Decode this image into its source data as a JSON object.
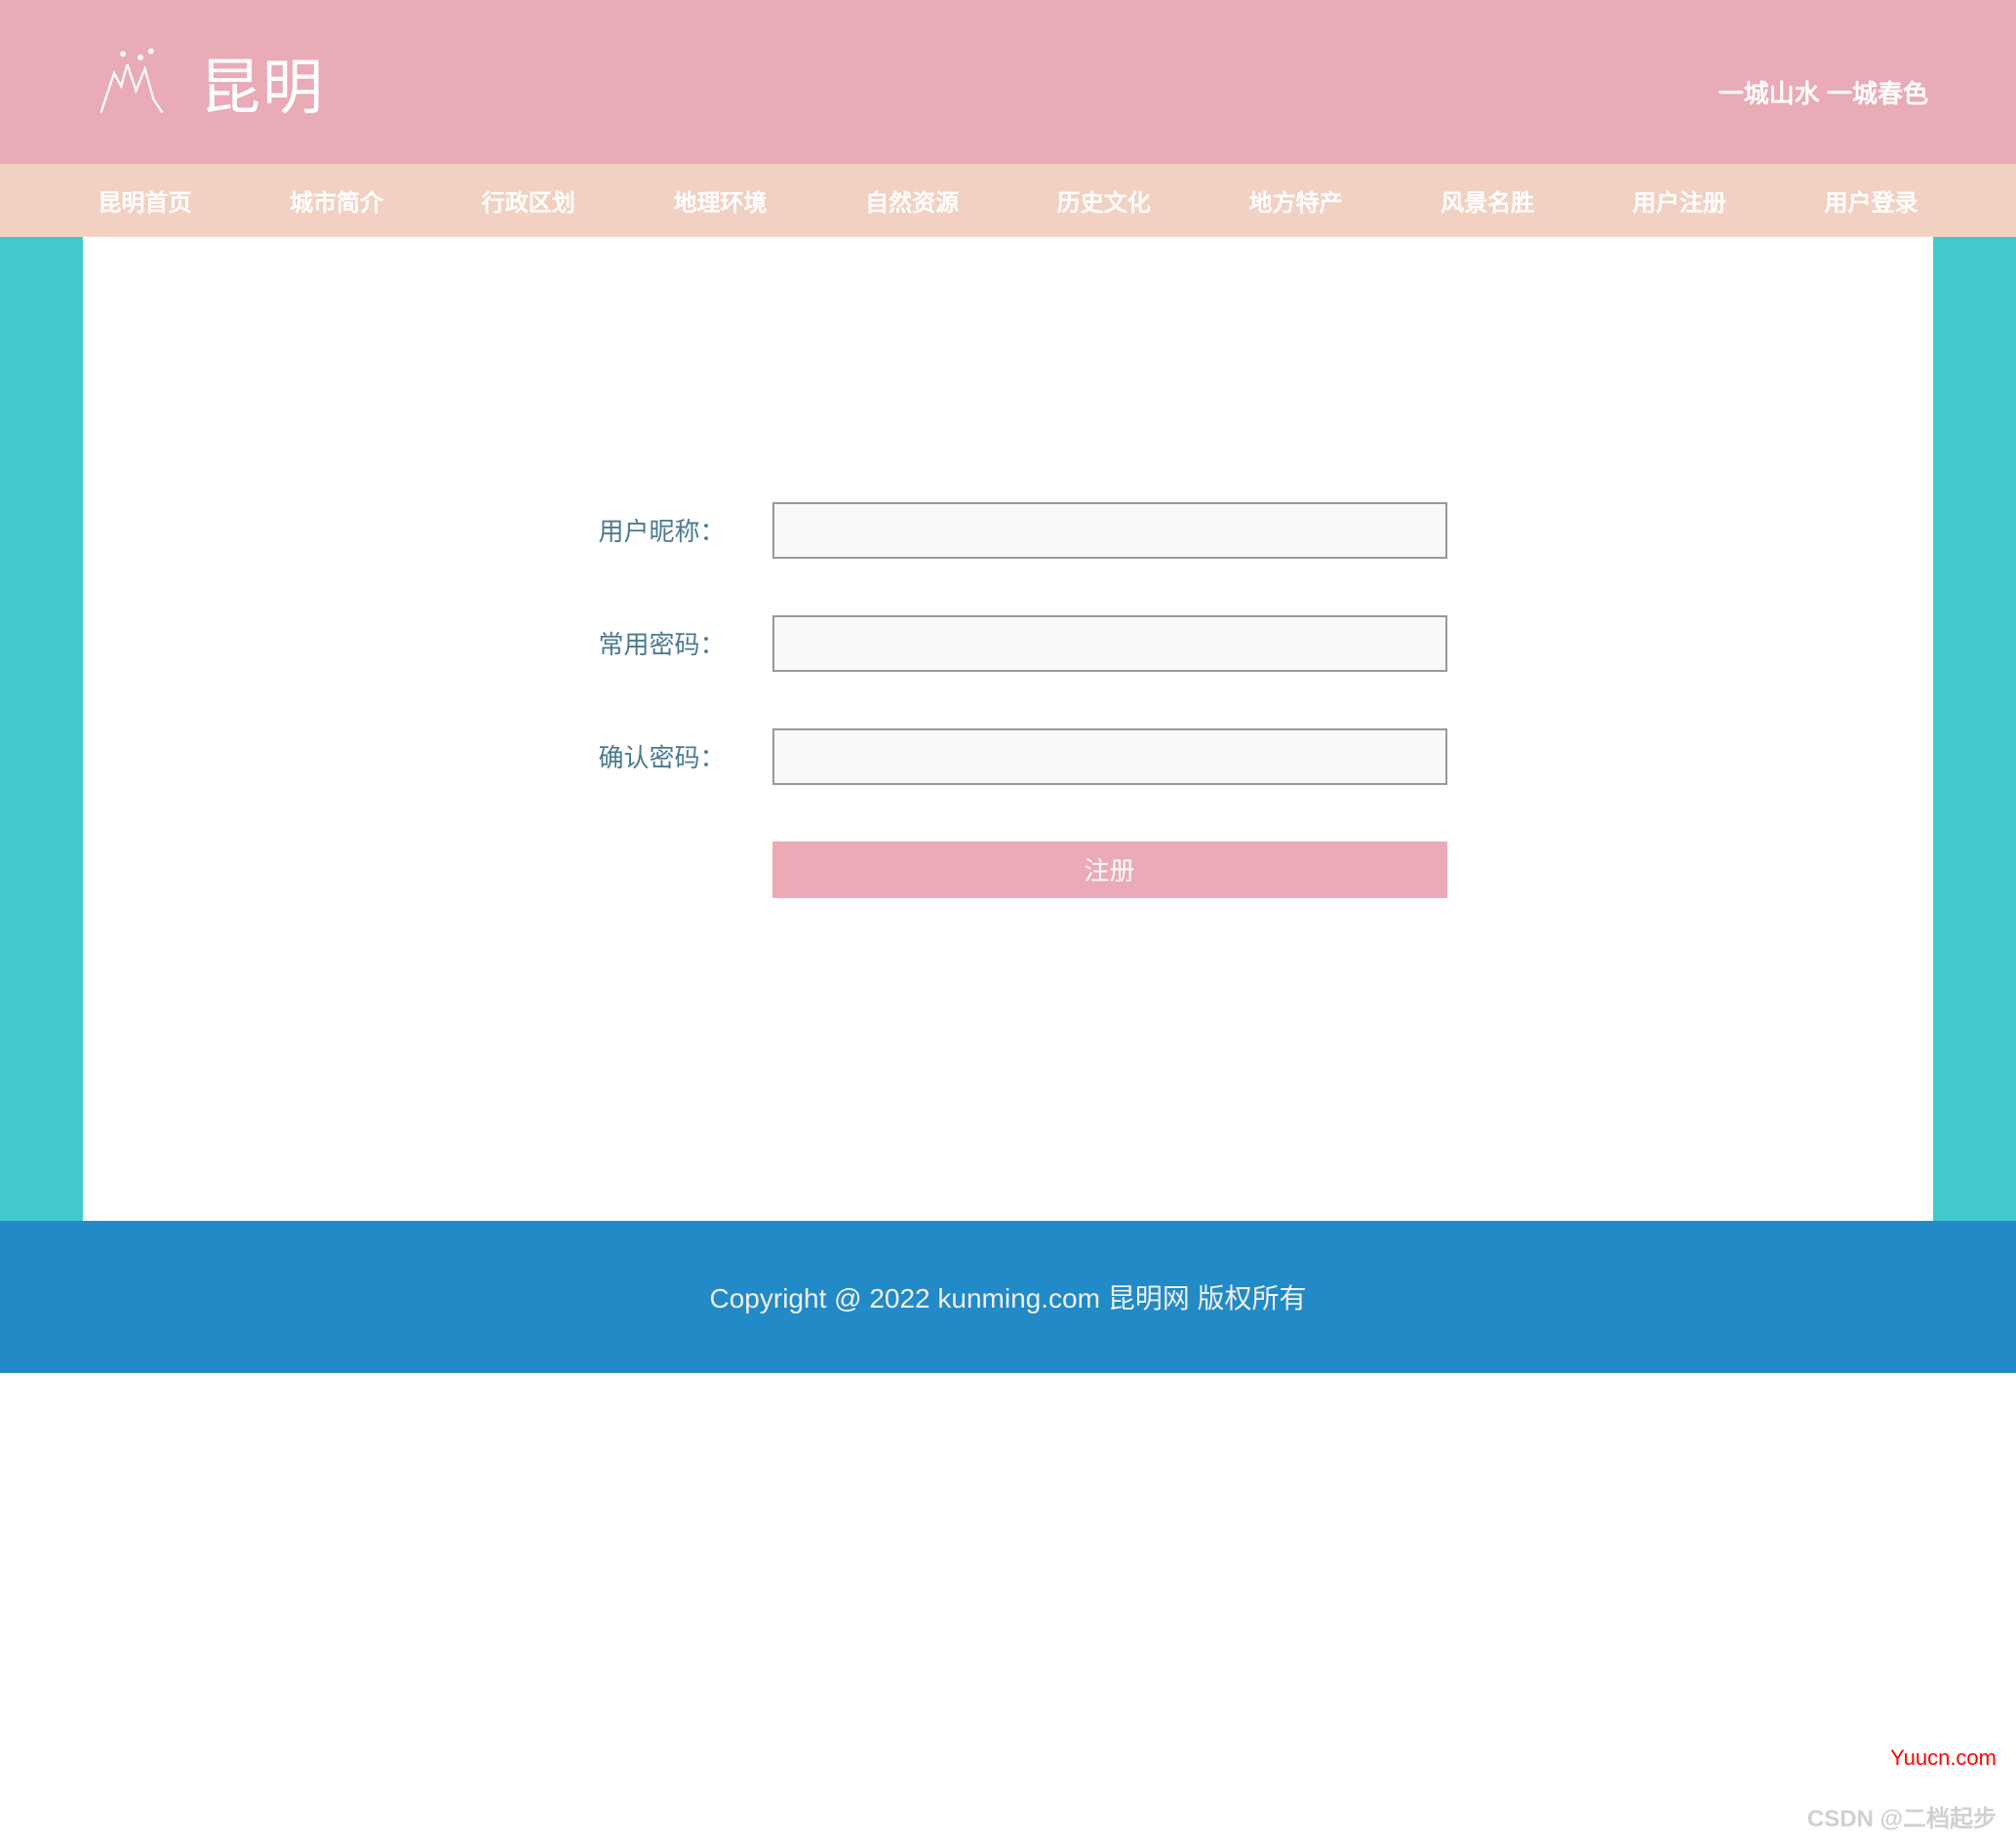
{
  "header": {
    "title": "昆明",
    "tagline": "一城山水 一城春色"
  },
  "nav": {
    "items": [
      "昆明首页",
      "城市简介",
      "行政区划",
      "地理环境",
      "自然资源",
      "历史文化",
      "地方特产",
      "风景名胜",
      "用户注册",
      "用户登录"
    ]
  },
  "form": {
    "nickname_label": "用户昵称：",
    "nickname_value": "",
    "password_label": "常用密码：",
    "password_value": "",
    "confirm_label": "确认密码：",
    "confirm_value": "",
    "submit_label": "注册"
  },
  "footer": {
    "copyright": "Copyright @ 2022 kunming.com 昆明网 版权所有"
  },
  "watermarks": {
    "yuucn": "Yuucn.com",
    "csdn": "CSDN @二档起步"
  }
}
